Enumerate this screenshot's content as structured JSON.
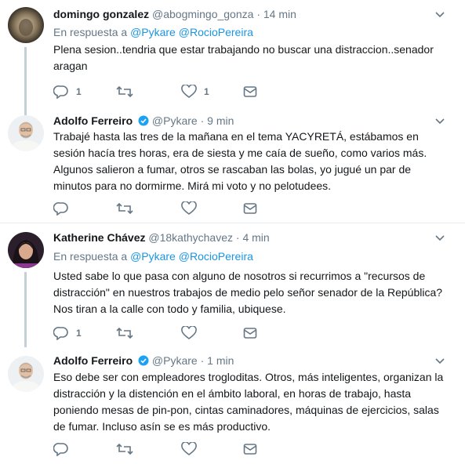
{
  "tweets": [
    {
      "name": "domingo gonzalez",
      "handle": "@abogmingo_gonza",
      "dot": "·",
      "time": "14 min",
      "verified": false,
      "reply_prefix": "En respuesta a",
      "reply_mentions": [
        "@Pykare",
        "@RocioPereira"
      ],
      "text": "Plena sesion..tendria que estar trabajando no buscar una distraccion..senador aragan",
      "reply_count": "1",
      "retweet_count": "",
      "like_count": "1"
    },
    {
      "name": "Adolfo Ferreiro",
      "handle": "@Pykare",
      "dot": "·",
      "time": "9 min",
      "verified": true,
      "text": "Trabajé hasta las tres de la mañana en el tema YACYRETÁ, estábamos en sesión hacía tres horas, era de siesta y me caía de sueño, como varios más. Algunos salieron a fumar, otros se rascaban las bolas, yo jugué un par de minutos para no dormirme. Mirá mi voto y no pelotudees.",
      "reply_count": "",
      "retweet_count": "",
      "like_count": ""
    },
    {
      "name": "Katherine Chávez",
      "handle": "@18kathychavez",
      "dot": "·",
      "time": "4 min",
      "verified": false,
      "reply_prefix": "En respuesta a",
      "reply_mentions": [
        "@Pykare",
        "@RocioPereira"
      ],
      "text": "Usted sabe lo que pasa con alguno de nosotros si recurrimos a \"recursos de distracción\" en nuestros trabajos de medio pelo señor senador de la República? Nos tiran a la calle con todo y familia, ubiquese.",
      "reply_count": "1",
      "retweet_count": "",
      "like_count": ""
    },
    {
      "name": "Adolfo Ferreiro",
      "handle": "@Pykare",
      "dot": "·",
      "time": "1 min",
      "verified": true,
      "text": "Eso debe ser con empleadores trogloditas. Otros, más inteligentes, organizan la distracción y la distención en el ámbito laboral, en horas de trabajo, hasta poniendo mesas de pin-pon, cintas caminadores, máquinas de ejercicios, salas de fumar. Incluso asín se es más productivo.",
      "reply_count": "",
      "retweet_count": "",
      "like_count": ""
    }
  ],
  "colors": {
    "link": "#1b95e0",
    "verified": "#1da1f2",
    "muted": "#657786",
    "thread_line": "#c4cfd6"
  },
  "icons": [
    "reply-icon",
    "retweet-icon",
    "like-icon",
    "dm-icon",
    "verified-icon",
    "chevron-down-icon"
  ]
}
